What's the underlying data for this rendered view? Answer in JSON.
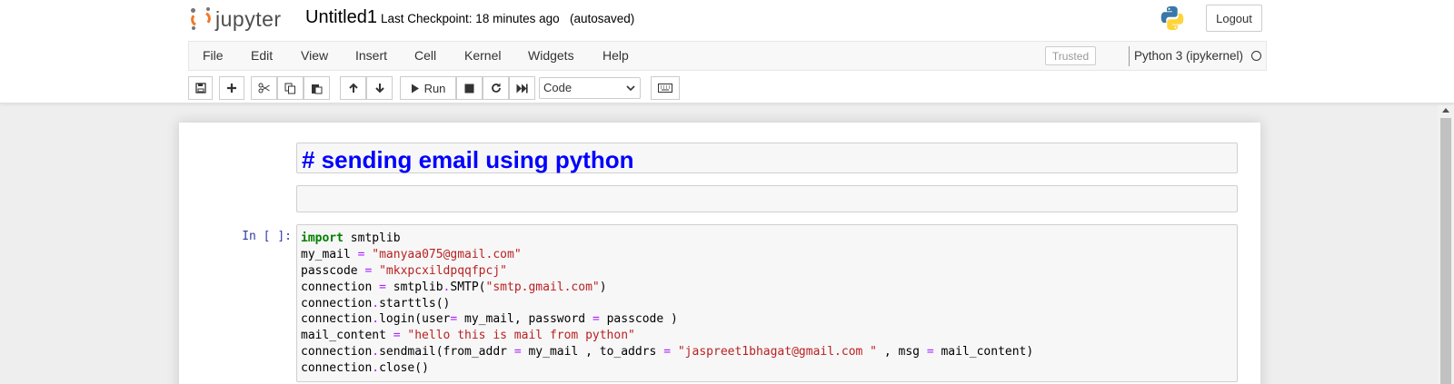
{
  "header": {
    "logo_text": "jupyter",
    "notebook_name": "Untitled1",
    "checkpoint": "Last Checkpoint: 18 minutes ago",
    "autosave_status": "(autosaved)",
    "logout_label": "Logout",
    "icons": [
      "jupyter-logo-icon",
      "python-logo-icon"
    ]
  },
  "menubar": {
    "items": [
      "File",
      "Edit",
      "View",
      "Insert",
      "Cell",
      "Kernel",
      "Widgets",
      "Help"
    ],
    "trusted_label": "Trusted",
    "kernel_name": "Python 3 (ipykernel)",
    "kernel_status_icon": "kernel-idle-circle-icon"
  },
  "toolbar": {
    "buttons": [
      "save-icon",
      "plus-icon",
      "cut-icon",
      "copy-icon",
      "paste-icon",
      "arrow-up-icon",
      "arrow-down-icon",
      "run-icon",
      "stop-icon",
      "restart-icon",
      "fast-forward-icon",
      "keyboard-icon"
    ],
    "run_label": "Run",
    "cell_type": "Code"
  },
  "cells": {
    "markdown": "# sending email using python",
    "empty": "",
    "code_prompt": "In [ ]:",
    "code_lines": [
      "import smtplib",
      "my_mail = \"manyaa075@gmail.com\"",
      "passcode = \"mkxpcxildpqqfpcj\"",
      "connection = smtplib.SMTP(\"smtp.gmail.com\")",
      "connection.starttls()",
      "connection.login(user= my_mail, password = passcode )",
      "mail_content = \"hello this is mail from python\"",
      "connection.sendmail(from_addr = my_mail , to_addrs = \"jaspreet1bhagat@gmail.com \" , msg = mail_content)",
      "connection.close()"
    ]
  },
  "colors": {
    "accent_orange": "#f37726",
    "prompt_blue": "#303f9f",
    "markdown_blue": "#0000ff",
    "keyword_green": "#008000",
    "string_red": "#ba2121",
    "operator_purple": "#aa22ff"
  }
}
